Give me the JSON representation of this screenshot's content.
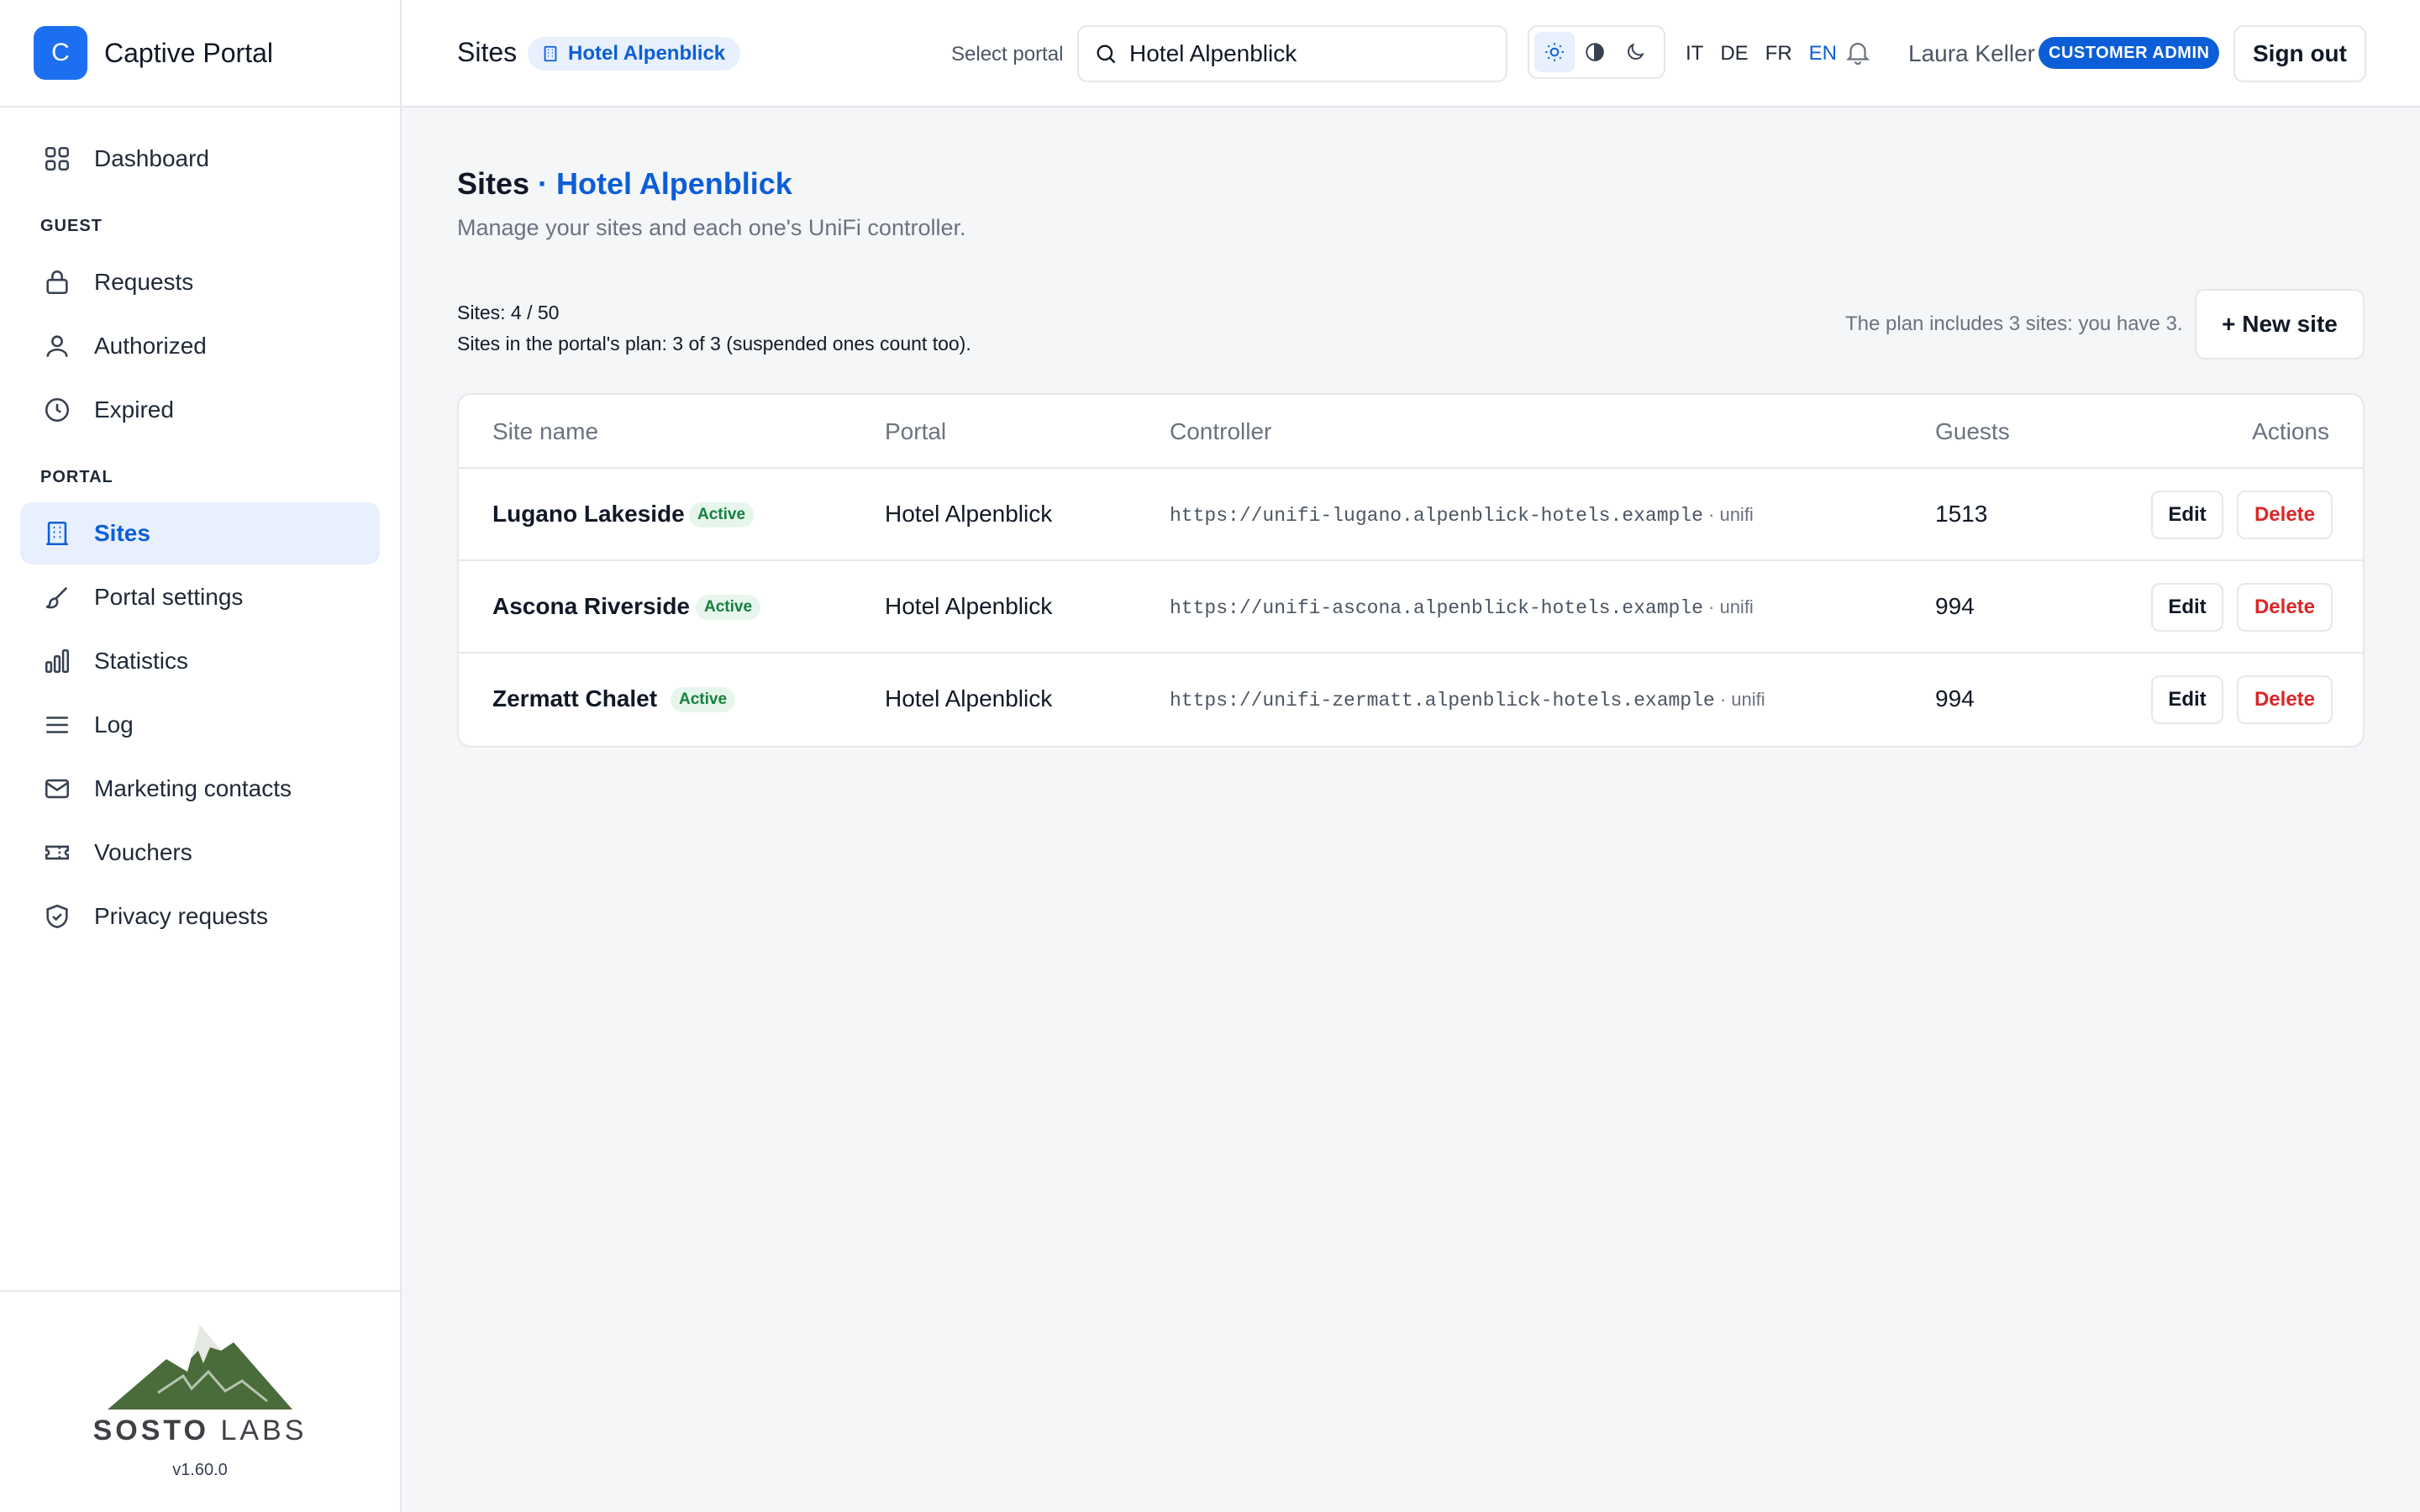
{
  "brand": {
    "logo_letter": "C",
    "name": "Captive Portal"
  },
  "sidebar": {
    "dashboard": "Dashboard",
    "guest_section": "GUEST",
    "requests": "Requests",
    "authorized": "Authorized",
    "expired": "Expired",
    "portal_section": "PORTAL",
    "sites": "Sites",
    "portal_settings": "Portal settings",
    "statistics": "Statistics",
    "log": "Log",
    "marketing_contacts": "Marketing contacts",
    "vouchers": "Vouchers",
    "privacy_requests": "Privacy requests",
    "active_item": "Sites"
  },
  "footer": {
    "logo_strong": "SOSTO",
    "logo_light": " LABS",
    "version": "v1.60.0"
  },
  "topbar": {
    "title": "Sites",
    "portal_chip": "Hotel Alpenblick",
    "select_label": "Select portal",
    "portal_search_value": "Hotel Alpenblick",
    "languages": [
      "IT",
      "DE",
      "FR",
      "EN"
    ],
    "selected_language": "EN",
    "user_name": "Laura Keller",
    "role_badge": "CUSTOMER ADMIN",
    "sign_out": "Sign out",
    "theme_selected": "light"
  },
  "page": {
    "title": "Sites",
    "title_sep": " · ",
    "title_portal": "Hotel Alpenblick",
    "subtitle": "Manage your sites and each one's UniFi controller.",
    "sites_count": "Sites: 4 / 50",
    "plan_count": "Sites in the portal's plan: 3 of 3 (suspended ones count too).",
    "plan_note": "The plan includes 3 sites: you have 3.",
    "new_site": "+ New site"
  },
  "table": {
    "headers": {
      "site_name": "Site name",
      "portal": "Portal",
      "controller": "Controller",
      "guests": "Guests",
      "actions": "Actions"
    },
    "edit_label": "Edit",
    "delete_label": "Delete",
    "rows": [
      {
        "name": "Lugano Lakeside",
        "status": "Active",
        "portal": "Hotel Alpenblick",
        "controller": "https://unifi-lugano.alpenblick-hotels.example",
        "controller_type": " · unifi",
        "guests": "1513"
      },
      {
        "name": "Ascona Riverside",
        "status": "Active",
        "portal": "Hotel Alpenblick",
        "controller": "https://unifi-ascona.alpenblick-hotels.example",
        "controller_type": " · unifi",
        "guests": "994"
      },
      {
        "name": "Zermatt Chalet",
        "status": "Active",
        "portal": "Hotel Alpenblick",
        "controller": "https://unifi-zermatt.alpenblick-hotels.example",
        "controller_type": " · unifi",
        "guests": "994"
      }
    ]
  },
  "colors": {
    "accent": "#0b5ed7",
    "brand_blue": "#1d6ff2",
    "danger": "#dc2626",
    "success": "#15803d"
  }
}
